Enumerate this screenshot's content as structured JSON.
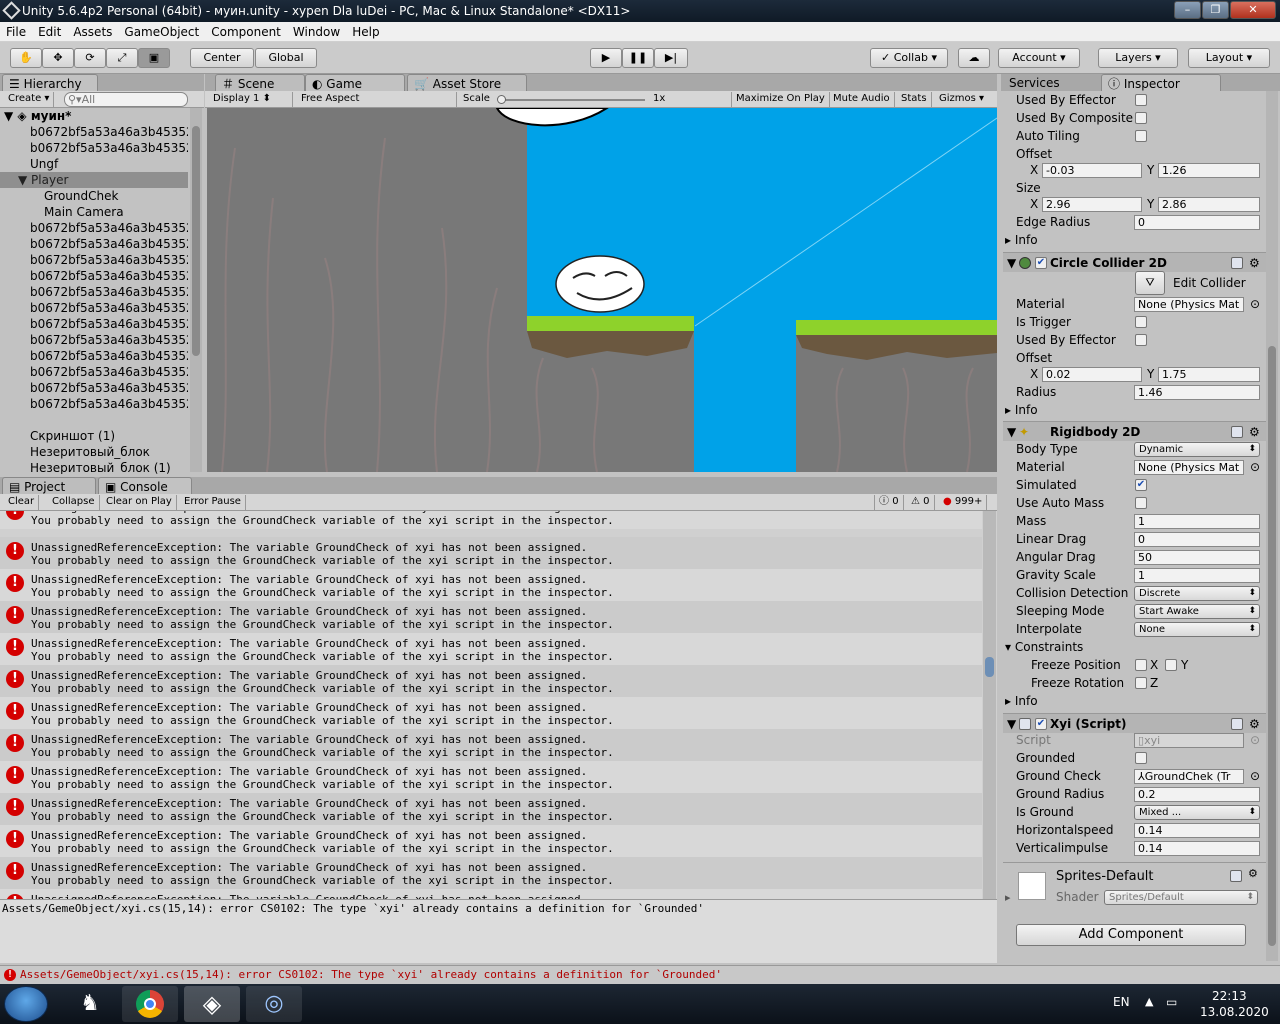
{
  "window": {
    "title": "Unity 5.6.4p2 Personal (64bit) - муин.unity - хуpen Dla luDei - PC, Mac & Linux Standalone* <DX11>"
  },
  "menu": [
    "File",
    "Edit",
    "Assets",
    "GameObject",
    "Component",
    "Window",
    "Help"
  ],
  "toolbar": {
    "center": "Center",
    "global": "Global",
    "collab": "Collab",
    "account": "Account",
    "layers": "Layers",
    "layout": "Layout"
  },
  "hierarchy": {
    "tab": "Hierarchy",
    "create": "Create",
    "search_placeholder": "All",
    "scene": "муин*",
    "items": [
      "b0672bf5a53a46a3b453523",
      "b0672bf5a53a46a3b453523",
      "Ungf",
      "Player",
      "GroundChek",
      "Main Camera",
      "b0672bf5a53a46a3b453523",
      "b0672bf5a53a46a3b453523",
      "b0672bf5a53a46a3b453523",
      "b0672bf5a53a46a3b453523",
      "b0672bf5a53a46a3b453523",
      "b0672bf5a53a46a3b453523",
      "b0672bf5a53a46a3b453523",
      "b0672bf5a53a46a3b453523",
      "b0672bf5a53a46a3b453523",
      "b0672bf5a53a46a3b453523",
      "b0672bf5a53a46a3b453523",
      "b0672bf5a53a46a3b453523",
      "Скриншот (1)",
      "Незеритовый_блок",
      "Незеритовый_блок (1)"
    ]
  },
  "game": {
    "tab_scene": "Scene",
    "tab_game": "Game",
    "tab_asset": "Asset Store",
    "display": "Display 1",
    "aspect": "Free Aspect",
    "scale_label": "Scale",
    "scale_value": "1x",
    "maximize": "Maximize On Play",
    "mute": "Mute Audio",
    "stats": "Stats",
    "gizmos": "Gizmos"
  },
  "console": {
    "tab_project": "Project",
    "tab_console": "Console",
    "clear": "Clear",
    "collapse": "Collapse",
    "clear_on_play": "Clear on Play",
    "error_pause": "Error Pause",
    "count_log": "0",
    "count_warn": "0",
    "count_err": "999+",
    "line1": "UnassignedReferenceException: The variable GroundCheck of xyi has not been assigned.",
    "line2": "You probably need to assign the GroundCheck variable of the xyi script in the inspector.",
    "detail": "Assets/GemeObject/xyi.cs(15,14): error CS0102: The type `xyi' already contains a definition for `Grounded'",
    "status": "Assets/GemeObject/xyi.cs(15,14): error CS0102: The type `xyi' already contains a definition for `Grounded'"
  },
  "inspector": {
    "tab_services": "Services",
    "tab_inspector": "Inspector",
    "box": {
      "used_by_effector": "Used By Effector",
      "used_by_composite": "Used By Composite",
      "auto_tiling": "Auto Tiling",
      "offset": "Offset",
      "offset_x": "-0.03",
      "offset_y": "1.26",
      "size": "Size",
      "size_x": "2.96",
      "size_y": "2.86",
      "edge_radius": "Edge Radius",
      "edge_radius_v": "0",
      "info": "Info"
    },
    "circle": {
      "title": "Circle Collider 2D",
      "edit": "Edit Collider",
      "material": "Material",
      "material_v": "None (Physics Mat",
      "is_trigger": "Is Trigger",
      "used_by_effector": "Used By Effector",
      "offset": "Offset",
      "offset_x": "0.02",
      "offset_y": "1.75",
      "radius": "Radius",
      "radius_v": "1.46",
      "info": "Info"
    },
    "rigidbody": {
      "title": "Rigidbody 2D",
      "body_type": "Body Type",
      "body_type_v": "Dynamic",
      "material": "Material",
      "material_v": "None (Physics Mat",
      "simulated": "Simulated",
      "use_auto_mass": "Use Auto Mass",
      "mass": "Mass",
      "mass_v": "1",
      "linear_drag": "Linear Drag",
      "linear_drag_v": "0",
      "angular_drag": "Angular Drag",
      "angular_drag_v": "50",
      "gravity_scale": "Gravity Scale",
      "gravity_scale_v": "1",
      "collision": "Collision Detection",
      "collision_v": "Discrete",
      "sleeping": "Sleeping Mode",
      "sleeping_v": "Start Awake",
      "interpolate": "Interpolate",
      "interpolate_v": "None",
      "constraints": "Constraints",
      "freeze_pos": "Freeze Position",
      "freeze_rot": "Freeze Rotation",
      "x": "X",
      "y": "Y",
      "z": "Z",
      "info": "Info"
    },
    "script": {
      "title": "Xyi (Script)",
      "script": "Script",
      "script_v": "xyi",
      "grounded": "Grounded",
      "ground_check": "Ground Check",
      "ground_check_v": "GroundChek (Tr",
      "ground_radius": "Ground Radius",
      "ground_radius_v": "0.2",
      "is_ground": "Is Ground",
      "is_ground_v": "Mixed ...",
      "hspeed": "Horizontalspeed",
      "hspeed_v": "0.14",
      "vimpulse": "Verticalimpulse",
      "vimpulse_v": "0.14"
    },
    "material": {
      "name": "Sprites-Default",
      "shader": "Shader",
      "shader_v": "Sprites/Default"
    },
    "add_component": "Add Component"
  },
  "taskbar": {
    "lang": "EN",
    "time": "22:13",
    "date": "13.08.2020"
  },
  "colors": {
    "sky": "#00a2e8",
    "grass": "#8ed22b",
    "error": "#d40000"
  }
}
